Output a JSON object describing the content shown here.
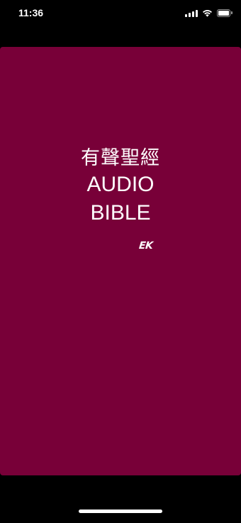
{
  "status_bar": {
    "time": "11:36",
    "icons": [
      "signal-icon",
      "wifi-icon",
      "battery-icon"
    ]
  },
  "splash": {
    "background_color": "#780038",
    "title_chinese": "有聲聖經",
    "title_line1": "AUDIO",
    "title_line2": "BIBLE",
    "logo_text": "EK"
  },
  "colors": {
    "text": "#ffffff",
    "frame": "#000000"
  }
}
